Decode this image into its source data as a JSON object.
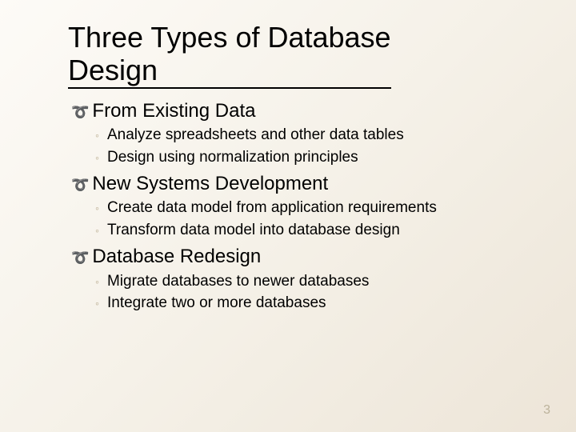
{
  "title_line1": "Three Types of Database",
  "title_line2": "Design",
  "sections": [
    {
      "heading": "From Existing Data",
      "items": [
        "Analyze spreadsheets and other data tables",
        "Design using normalization principles"
      ]
    },
    {
      "heading": "New Systems Development",
      "items": [
        "Create data model from application requirements",
        "Transform data model into database design"
      ]
    },
    {
      "heading": "Database Redesign",
      "items": [
        "Migrate databases to newer databases",
        "Integrate two or more databases"
      ]
    }
  ],
  "page_number": "3"
}
